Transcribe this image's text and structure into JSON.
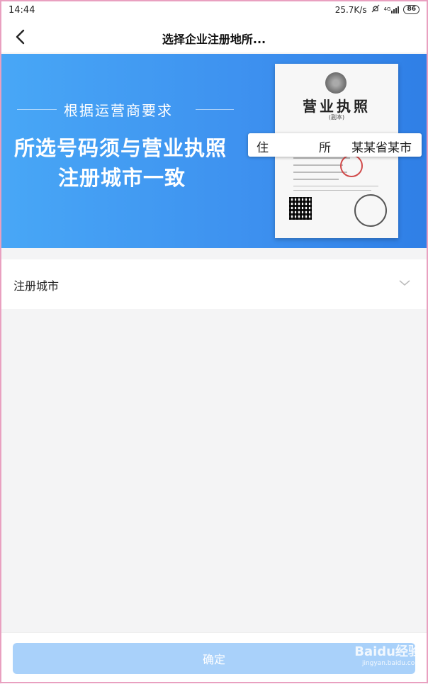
{
  "status_bar": {
    "time": "14:44",
    "network_speed": "25.7K/s",
    "signal_label": "4G",
    "battery": "86"
  },
  "nav": {
    "title": "选择企业注册地所..."
  },
  "banner": {
    "subtitle": "根据运营商要求",
    "headline_line1": "所选号码须与营业执照",
    "headline_line2": "注册城市一致",
    "license_title": "营业执照",
    "license_sub": "(副本)",
    "address_label_1": "住",
    "address_label_2": "所",
    "address_value": "某某省某市"
  },
  "form": {
    "city_label": "注册城市"
  },
  "footer": {
    "confirm_label": "确定"
  },
  "watermark": {
    "line1": "Baidu经验",
    "line2": "jingyan.baidu.com"
  },
  "colors": {
    "banner_start": "#48a7f6",
    "banner_end": "#2f7fe6",
    "confirm_disabled": "#a9d1fa",
    "page_bg": "#f4f4f5"
  },
  "icons": [
    "back-arrow-icon",
    "chevron-down-icon",
    "battery-icon",
    "signal-icon",
    "mute-icon"
  ]
}
